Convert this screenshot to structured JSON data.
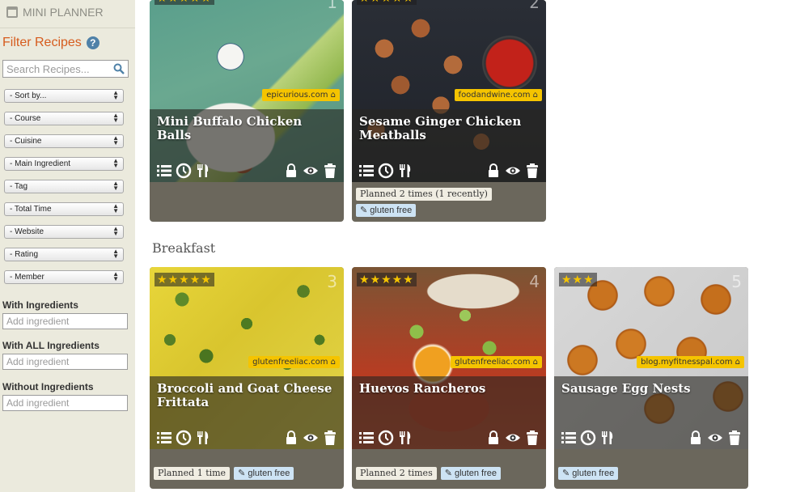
{
  "sidebar": {
    "mini_planner": "MINI PLANNER",
    "filter_title": "Filter Recipes",
    "help": "?",
    "search_placeholder": "Search Recipes...",
    "selects": [
      "- Sort by...",
      "- Course",
      "- Cuisine",
      "- Main Ingredient",
      "- Tag",
      "- Total Time",
      "- Website",
      "- Rating",
      "- Member"
    ],
    "with_label": "With Ingredients",
    "with_all_label": "With ALL Ingredients",
    "without_label": "Without Ingredients",
    "add_placeholder": "Add ingredient"
  },
  "section_breakfast": "Breakfast",
  "cards": [
    {
      "title": "Mini Buffalo Chicken Balls",
      "source": "epicurious.com",
      "number": "1",
      "stars": "★★★★★",
      "planned": "",
      "tag": ""
    },
    {
      "title": "Sesame Ginger Chicken Meatballs",
      "source": "foodandwine.com",
      "number": "2",
      "stars": "★★★★★",
      "planned": "Planned 2 times (1 recently)",
      "tag": "gluten free"
    },
    {
      "title": "Broccoli and Goat Cheese Frittata",
      "source": "glutenfreeliac.com",
      "number": "3",
      "stars": "★★★★★",
      "planned": "Planned 1 time",
      "tag": "gluten free"
    },
    {
      "title": "Huevos Rancheros",
      "source": "glutenfreeliac.com",
      "number": "4",
      "stars": "★★★★★",
      "planned": "Planned 2 times",
      "tag": "gluten free"
    },
    {
      "title": "Sausage Egg Nests",
      "source": "blog.myfitnesspal.com",
      "number": "5",
      "stars": "★★★",
      "planned": "",
      "tag": "gluten free"
    }
  ],
  "colors": {
    "accent": "#d65c1e",
    "source_badge": "#f5c400",
    "tag_gf": "#cde3f4",
    "sidebar_bg": "#ebeadd"
  }
}
